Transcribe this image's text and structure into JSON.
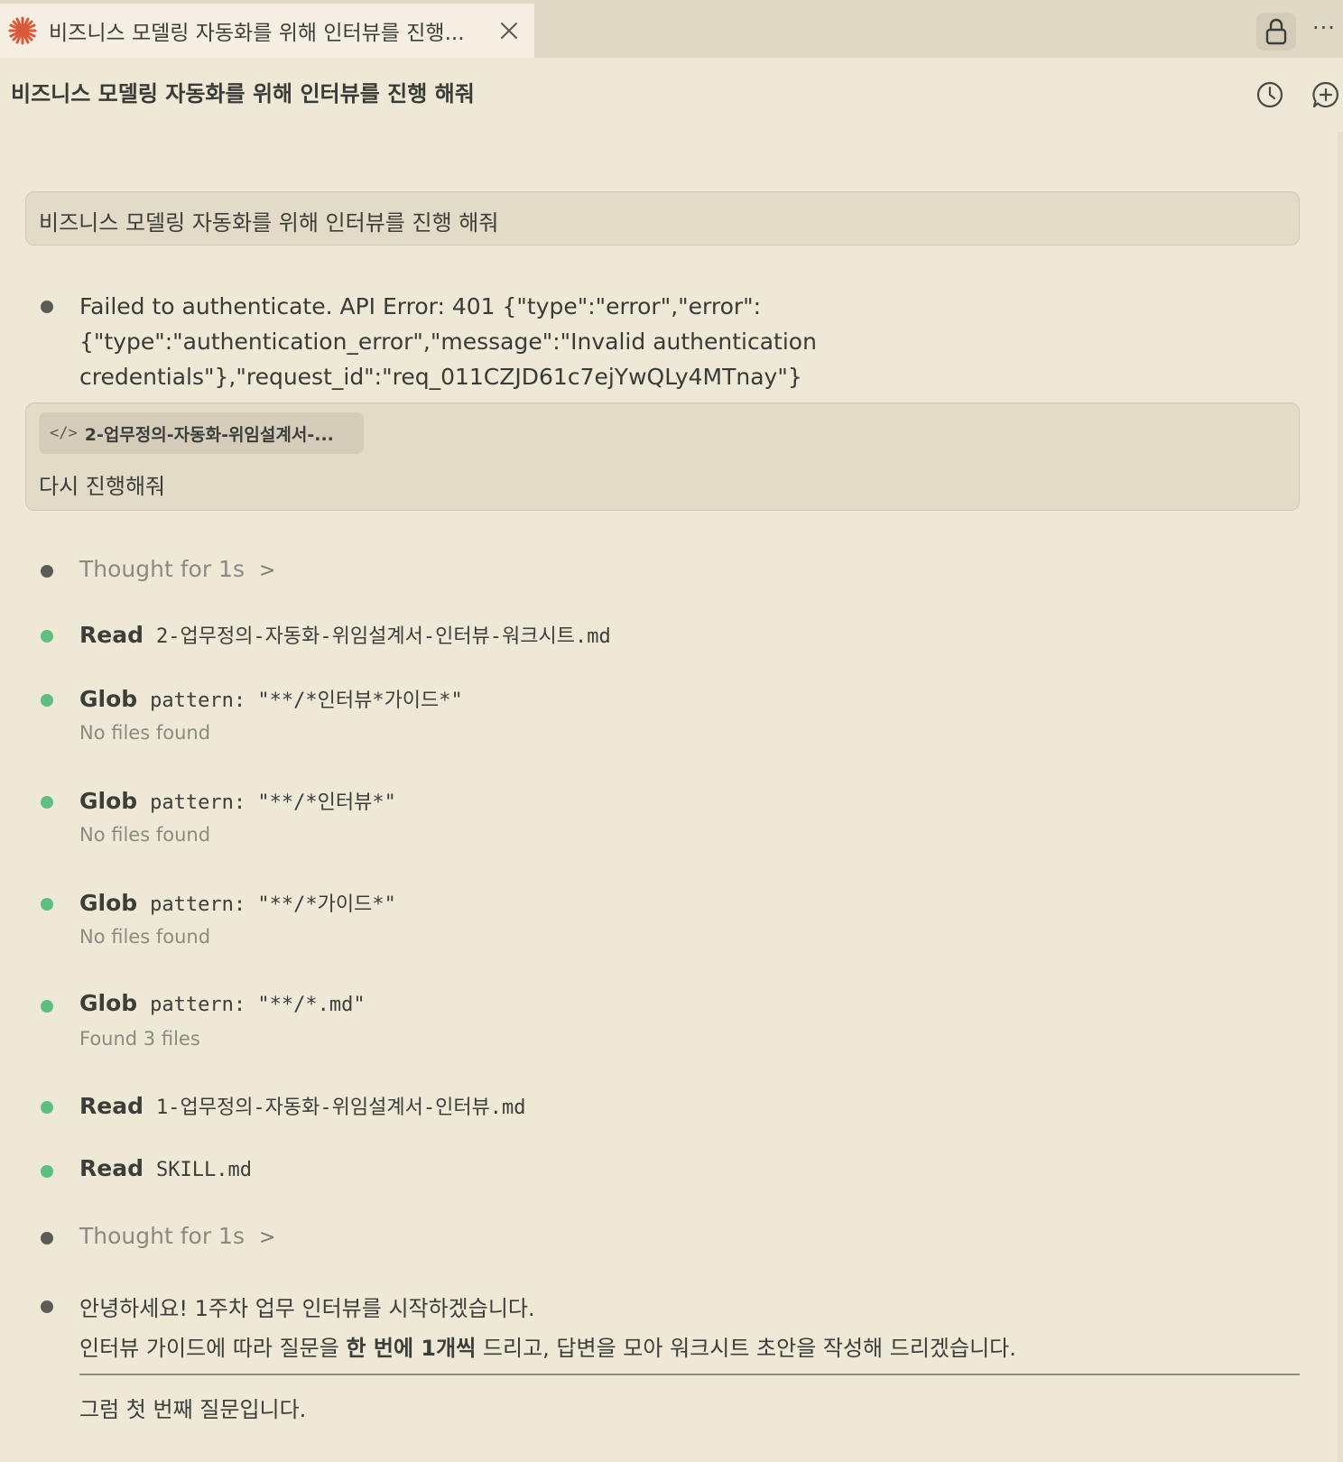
{
  "tab": {
    "title": "비즈니스 모델링 자동화를 위해 인터뷰를 진행..."
  },
  "header": {
    "title": "비즈니스 모델링 자동화를 위해 인터뷰를 진행 해줘"
  },
  "icons": {
    "tab": "claude-asterisk-icon",
    "close": "close-icon",
    "lock": "lock-icon",
    "more": "more-icon",
    "history": "history-icon",
    "new_chat": "new-chat-icon",
    "code": "code-icon",
    "chevron": "chevron-right-icon"
  },
  "colors": {
    "accent": "#d9593d",
    "success": "#5fbf80",
    "neutral": "#5b5b57"
  },
  "messages": {
    "user1": "비즈니스 모델링 자동화를 위해 인터뷰를 진행 해줘",
    "error": "Failed to authenticate. API Error: 401 {\"type\":\"error\",\"error\":{\"type\":\"authentication_error\",\"message\":\"Invalid authentication credentials\"},\"request_id\":\"req_011CZJD61c7ejYwQLy4MTnay\"}",
    "user2_file": "2-업무정의-자동화-위임설계서-...",
    "user2_text": "다시 진행해줘",
    "code_glyph": "</>"
  },
  "log": {
    "thought1": "Thought for 1s",
    "read1": {
      "tool": "Read",
      "arg": "2-업무정의-자동화-위임설계서-인터뷰-워크시트.md"
    },
    "glob1": {
      "tool": "Glob",
      "arg": "pattern: \"**/*인터뷰*가이드*\"",
      "result": "No files found"
    },
    "glob2": {
      "tool": "Glob",
      "arg": "pattern: \"**/*인터뷰*\"",
      "result": "No files found"
    },
    "glob3": {
      "tool": "Glob",
      "arg": "pattern: \"**/*가이드*\"",
      "result": "No files found"
    },
    "glob4": {
      "tool": "Glob",
      "arg": "pattern: \"**/*.md\"",
      "result": "Found 3 files"
    },
    "read2": {
      "tool": "Read",
      "arg": "1-업무정의-자동화-위임설계서-인터뷰.md"
    },
    "read3": {
      "tool": "Read",
      "arg": "SKILL.md"
    },
    "thought2": "Thought for 1s",
    "chevron": ">"
  },
  "reply": {
    "line1": "안녕하세요! 1주차 업무 인터뷰를 시작하겠습니다.",
    "line2_pre": "인터뷰 가이드에 따라 질문을 ",
    "line2_bold": "한 번에 1개씩",
    "line2_post": " 드리고, 답변을 모아 워크시트 초안을 작성해 드리겠습니다.",
    "line3": "그럼 첫 번째 질문입니다."
  },
  "tab_more": "···"
}
